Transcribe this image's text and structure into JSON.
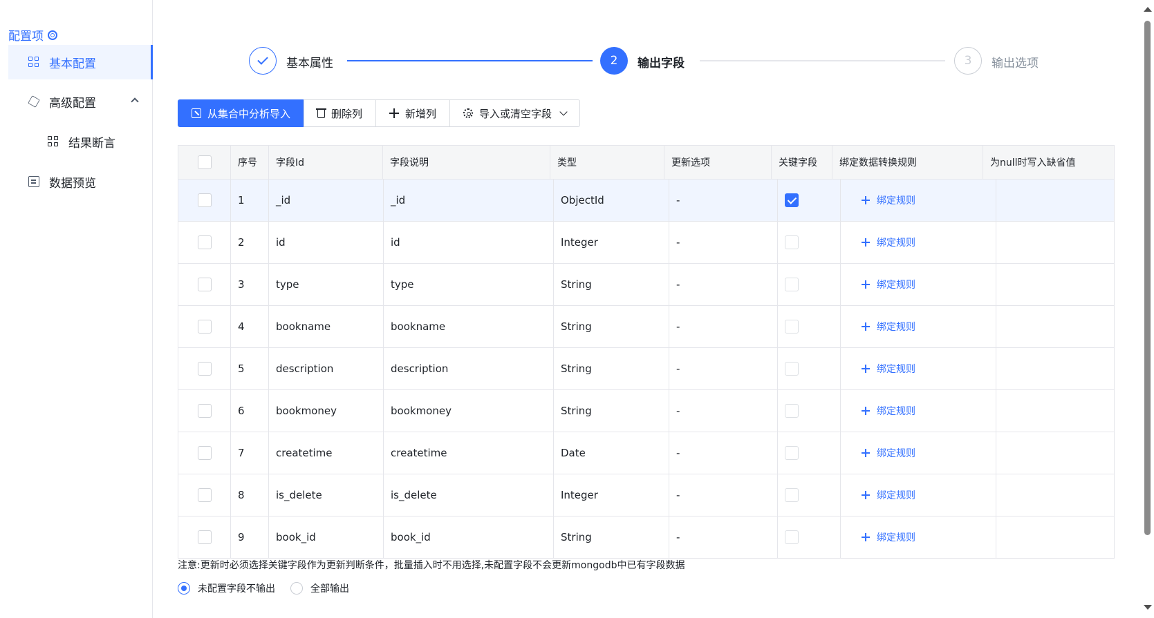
{
  "sidebar": {
    "title": "配置项",
    "items": [
      {
        "label": "基本配置",
        "icon": "grid-icon"
      },
      {
        "label": "高级配置",
        "icon": "cube-icon"
      },
      {
        "label": "结果断言",
        "icon": "grid-icon"
      },
      {
        "label": "数据预览",
        "icon": "document-icon"
      }
    ]
  },
  "steps": [
    {
      "label": "基本属性",
      "state": "done"
    },
    {
      "num": "2",
      "label": "输出字段",
      "state": "active"
    },
    {
      "num": "3",
      "label": "输出选项",
      "state": "pending"
    }
  ],
  "toolbar": {
    "import_label": "从集合中分析导入",
    "delete_label": "删除列",
    "add_label": "新增列",
    "import_clear_label": "导入或清空字段"
  },
  "table": {
    "headers": [
      "序号",
      "字段Id",
      "字段说明",
      "类型",
      "更新选项",
      "关键字段",
      "绑定数据转换规则",
      "为null时写入缺省值"
    ],
    "bind_label": "绑定规则",
    "rows": [
      {
        "no": "1",
        "id": "_id",
        "desc": "_id",
        "type": "ObjectId",
        "update": "-",
        "key": true
      },
      {
        "no": "2",
        "id": "id",
        "desc": "id",
        "type": "Integer",
        "update": "-",
        "key": false
      },
      {
        "no": "3",
        "id": "type",
        "desc": "type",
        "type": "String",
        "update": "-",
        "key": false
      },
      {
        "no": "4",
        "id": "bookname",
        "desc": "bookname",
        "type": "String",
        "update": "-",
        "key": false
      },
      {
        "no": "5",
        "id": "description",
        "desc": "description",
        "type": "String",
        "update": "-",
        "key": false
      },
      {
        "no": "6",
        "id": "bookmoney",
        "desc": "bookmoney",
        "type": "String",
        "update": "-",
        "key": false
      },
      {
        "no": "7",
        "id": "createtime",
        "desc": "createtime",
        "type": "Date",
        "update": "-",
        "key": false
      },
      {
        "no": "8",
        "id": "is_delete",
        "desc": "is_delete",
        "type": "Integer",
        "update": "-",
        "key": false
      },
      {
        "no": "9",
        "id": "book_id",
        "desc": "book_id",
        "type": "String",
        "update": "-",
        "key": false
      }
    ]
  },
  "note": "注意:更新时必须选择关键字段作为更新判断条件，批量插入时不用选择,未配置字段不会更新mongodb中已有字段数据",
  "output_options": [
    {
      "label": "未配置字段不输出",
      "selected": true
    },
    {
      "label": "全部输出",
      "selected": false
    }
  ],
  "colors": {
    "accent": "#3370ff",
    "highlight_row": "#f0f5ff"
  }
}
